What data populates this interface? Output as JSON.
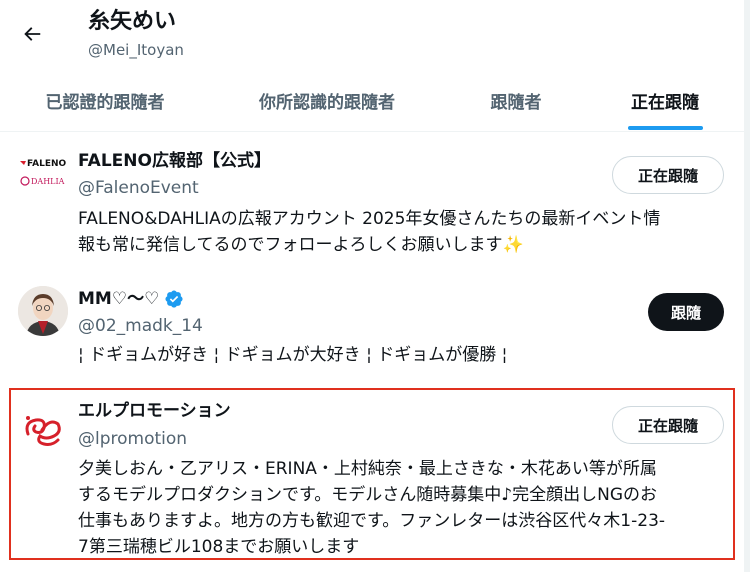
{
  "header": {
    "title": "糸矢めい",
    "handle": "@Mei_Itoyan"
  },
  "tabs": [
    {
      "label": "已認證的跟隨者"
    },
    {
      "label": "你所認識的跟隨者"
    },
    {
      "label": "跟隨者"
    },
    {
      "label": "正在跟隨"
    }
  ],
  "users": [
    {
      "name": "FALENO広報部【公式】",
      "handle": "@FalenoEvent",
      "bio_lines": [
        "FALENO&DAHLIAの広報アカウント 2025年女優さんたちの最新イベント情",
        "報も常に発信してるのでフォローよろしくお願いします✨"
      ],
      "button": "正在跟隨",
      "avatar_text": {
        "line1": "FALENO",
        "line2": "DAHLIA"
      }
    },
    {
      "name": "MM♡〜♡",
      "handle": "@02_madk_14",
      "bio_lines": [
        "¦ ドギョムが好き ¦ ドギョムが大好き ¦ ドギョムが優勝 ¦"
      ],
      "button": "跟隨"
    },
    {
      "name": "エルプロモーション",
      "handle": "@lpromotion",
      "bio_lines": [
        "夕美しおん・乙アリス・ERINA・上村純奈・最上さきな・木花あい等が所属",
        "するモデルプロダクションです。モデルさん随時募集中♪完全顔出しNGのお",
        "仕事もありますよ。地方の方も歓迎です。ファンレターは渋谷区代々木1-23-",
        "7第三瑞穂ビル108までお願いします"
      ],
      "button": "正在跟隨"
    }
  ],
  "colors": {
    "accent": "#1d9bf0",
    "text": "#0f1419",
    "muted": "#536471",
    "highlight": "#e0301e",
    "faleno_red": "#d81e2c",
    "dahlia_pink": "#c2185b",
    "lpromo_red": "#d6202a"
  },
  "icons": [
    "back-arrow-icon",
    "verified-badge-icon"
  ]
}
